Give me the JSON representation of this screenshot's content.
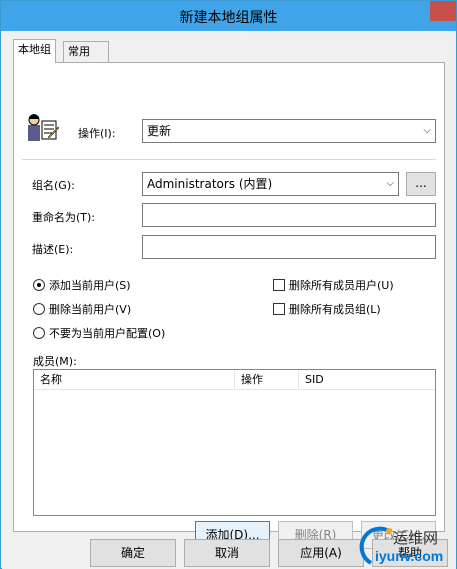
{
  "window": {
    "title": "新建本地组属性"
  },
  "tabs": [
    {
      "label": "本地组"
    },
    {
      "label": "常用"
    }
  ],
  "form": {
    "action_label": "操作(I):",
    "action_value": "更新",
    "group_name_label": "组名(G):",
    "group_name_value": "Administrators (内置)",
    "browse_label": "...",
    "rename_label": "重命名为(T):",
    "rename_value": "",
    "description_label": "描述(E):",
    "description_value": ""
  },
  "options": {
    "radios": [
      {
        "label": "添加当前用户(S)",
        "checked": true
      },
      {
        "label": "删除当前用户(V)",
        "checked": false
      },
      {
        "label": "不要为当前用户配置(O)",
        "checked": false
      }
    ],
    "checkboxes": [
      {
        "label": "删除所有成员用户(U)",
        "checked": false
      },
      {
        "label": "删除所有成员组(L)",
        "checked": false
      }
    ]
  },
  "members": {
    "label": "成员(M):",
    "columns": [
      "名称",
      "操作",
      "SID"
    ],
    "rows": []
  },
  "member_buttons": {
    "add": "添加(D)...",
    "remove": "删除(R)",
    "change": "更改(C)..."
  },
  "footer_buttons": {
    "ok": "确定",
    "cancel": "取消",
    "apply": "应用(A)",
    "help": "帮助"
  },
  "watermark": {
    "line1": "运维网",
    "line2": "iyunv.com"
  },
  "colors": {
    "titlebar": "#40a4e8",
    "close": "#c7504a",
    "accent": "#0078d7"
  }
}
